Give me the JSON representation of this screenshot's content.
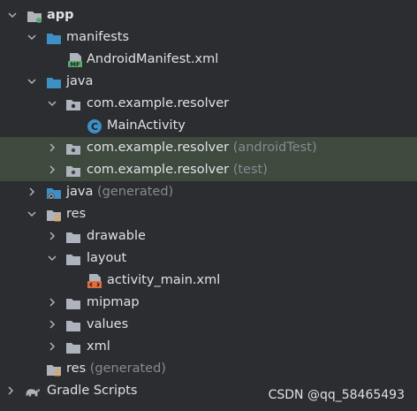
{
  "colors": {
    "background": "#2b2d30",
    "highlight_row": "#3f4a3f",
    "folder_blue": "#3d8fc4",
    "folder_grey": "#aeb3bd",
    "dim_text": "#868a91",
    "text": "#dfe1e5"
  },
  "tree": {
    "app": {
      "label": "app",
      "icon": "module-folder-icon",
      "expanded": true
    },
    "manifests": {
      "label": "manifests",
      "icon": "folder-icon",
      "expanded": true
    },
    "android_manifest": {
      "label": "AndroidManifest.xml",
      "icon": "manifest-file-icon",
      "badge": "MF"
    },
    "java": {
      "label": "java",
      "icon": "source-folder-icon",
      "expanded": true
    },
    "pkg_main": {
      "label": "com.example.resolver",
      "icon": "package-icon",
      "expanded": true
    },
    "main_activity": {
      "label": "MainActivity",
      "icon": "class-icon",
      "badge": "C"
    },
    "pkg_android_test": {
      "label": "com.example.resolver",
      "suffix": "(androidTest)",
      "icon": "package-icon",
      "expanded": false
    },
    "pkg_test": {
      "label": "com.example.resolver",
      "suffix": "(test)",
      "icon": "package-icon",
      "expanded": false
    },
    "java_generated": {
      "label": "java",
      "suffix": "(generated)",
      "icon": "generated-source-folder-icon",
      "expanded": false
    },
    "res": {
      "label": "res",
      "icon": "resource-folder-icon",
      "expanded": true
    },
    "drawable": {
      "label": "drawable",
      "icon": "folder-icon",
      "expanded": false
    },
    "layout": {
      "label": "layout",
      "icon": "folder-icon",
      "expanded": true
    },
    "activity_main": {
      "label": "activity_main.xml",
      "icon": "layout-file-icon"
    },
    "mipmap": {
      "label": "mipmap",
      "icon": "folder-icon",
      "expanded": false
    },
    "values": {
      "label": "values",
      "icon": "folder-icon",
      "expanded": false
    },
    "xml": {
      "label": "xml",
      "icon": "folder-icon",
      "expanded": false
    },
    "res_generated": {
      "label": "res",
      "suffix": "(generated)",
      "icon": "resource-folder-icon"
    },
    "gradle_scripts": {
      "label": "Gradle Scripts",
      "icon": "gradle-elephant-icon",
      "expanded": false
    }
  },
  "watermark": {
    "text": "CSDN @qq_58465493"
  }
}
